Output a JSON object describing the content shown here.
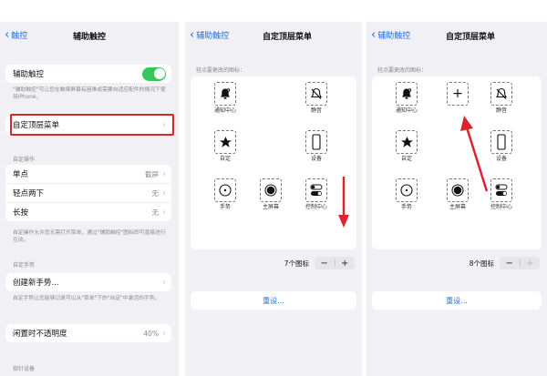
{
  "panel1": {
    "back_label": "触控",
    "title": "辅助触控",
    "assistive_touch": {
      "label": "辅助触控",
      "toggle_on": true
    },
    "assistive_note": "\"辅助触控\"可让您在触摸屏幕有困难或需要自适应配件的情况下使用iPhone。",
    "custom_menu": {
      "label": "自定顶层菜单"
    },
    "custom_actions_header": "自定操作",
    "actions": [
      {
        "label": "单点",
        "value": "截屏"
      },
      {
        "label": "轻点两下",
        "value": "无"
      },
      {
        "label": "长按",
        "value": "无"
      }
    ],
    "actions_note": "自定操作允许您无需打开菜单，通过\"辅助触控\"图标即可直接进行互动。",
    "custom_gestures_header": "自定手势",
    "create_gesture": {
      "label": "创建新手势..."
    },
    "gesture_note": "自定手势让您能够记录可以从\"菜单\"下的\"自定\"中激活的手势。",
    "idle_opacity": {
      "label": "闲置时不透明度",
      "value": "40%"
    },
    "pointer_header": "指针设备"
  },
  "panel2": {
    "back_label": "辅助触控",
    "title": "自定顶层菜单",
    "hint": "轻点要更改的图标：",
    "icons": [
      {
        "name": "notification",
        "label": "通知中心"
      },
      {
        "name": "mute",
        "label": "静音"
      },
      {
        "name": "custom",
        "label": "自定"
      },
      {
        "name": "device",
        "label": "设备"
      },
      {
        "name": "gesture",
        "label": "手势"
      },
      {
        "name": "home",
        "label": "主屏幕"
      },
      {
        "name": "control",
        "label": "控制中心"
      }
    ],
    "count": "7个图标",
    "minus": "−",
    "plus": "+",
    "reset": "重设..."
  },
  "panel3": {
    "back_label": "辅助触控",
    "title": "自定顶层菜单",
    "hint": "轻点要更改的图标：",
    "new_icon": "+",
    "icons": [
      {
        "name": "notification",
        "label": "通知中心"
      },
      {
        "name": "mute",
        "label": "静音"
      },
      {
        "name": "custom",
        "label": "自定"
      },
      {
        "name": "device",
        "label": "设备"
      },
      {
        "name": "gesture",
        "label": "手势"
      },
      {
        "name": "home",
        "label": "主屏幕"
      },
      {
        "name": "control",
        "label": "控制中心"
      }
    ],
    "count": "8个图标",
    "minus": "−",
    "plus": "+",
    "reset": "重设..."
  },
  "colors": {
    "accent": "#1e6fe6",
    "toggle_on": "#38c65b",
    "annotation_red": "#d9262e"
  }
}
